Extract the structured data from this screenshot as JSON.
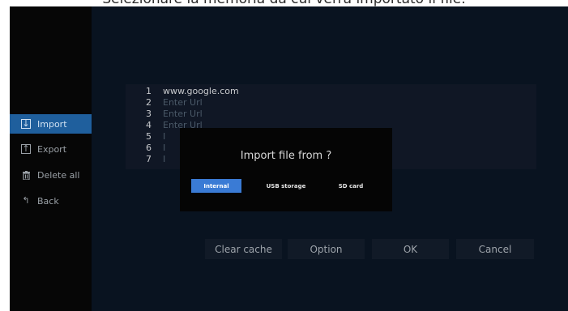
{
  "caption": "Selezionare la memoria da cui verrà importato il file.",
  "sidebar": {
    "items": [
      {
        "label": "Import",
        "icon": "import-icon",
        "active": true
      },
      {
        "label": "Export",
        "icon": "export-icon",
        "active": false
      },
      {
        "label": "Delete all",
        "icon": "trash-icon",
        "active": false
      },
      {
        "label": "Back",
        "icon": "back-icon",
        "active": false
      }
    ]
  },
  "url_list": {
    "rows": [
      {
        "num": "1",
        "value": "www.google.com"
      },
      {
        "num": "2",
        "value": "Enter Url"
      },
      {
        "num": "3",
        "value": "Enter Url"
      },
      {
        "num": "4",
        "value": "Enter Url"
      },
      {
        "num": "5",
        "value": "I"
      },
      {
        "num": "6",
        "value": "I"
      },
      {
        "num": "7",
        "value": "I"
      }
    ]
  },
  "dialog": {
    "title": "Import file from ?",
    "options": [
      {
        "label": "Internal",
        "selected": true
      },
      {
        "label": "USB storage",
        "selected": false
      },
      {
        "label": "SD card",
        "selected": false
      }
    ]
  },
  "bottom_buttons": {
    "clear_cache": "Clear cache",
    "option": "Option",
    "ok": "OK",
    "cancel": "Cancel"
  },
  "colors": {
    "accent": "#3a7bd5",
    "sidebar_active": "#1f5f9d",
    "background": "#091320"
  }
}
